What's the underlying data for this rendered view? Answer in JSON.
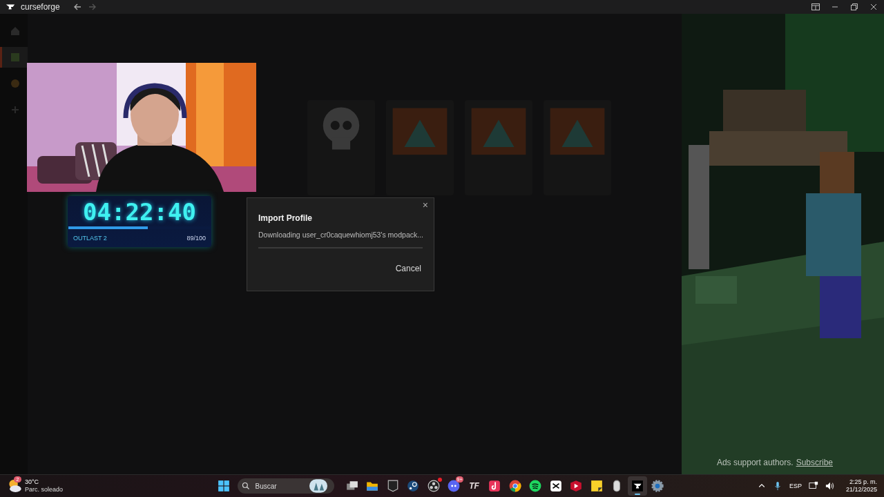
{
  "window": {
    "app_name": "curseforge",
    "back_disabled": false,
    "forward_disabled": true
  },
  "sidebar": {
    "items": [
      {
        "kind": "home",
        "selected": false
      },
      {
        "kind": "game",
        "selected": true
      },
      {
        "kind": "game2",
        "selected": false
      },
      {
        "kind": "add",
        "selected": false
      }
    ]
  },
  "library": {
    "cards": [
      {
        "kind": "skull"
      },
      {
        "kind": "art"
      },
      {
        "kind": "art"
      },
      {
        "kind": "art"
      }
    ]
  },
  "timer": {
    "time": "04:22:40",
    "level": 0.56,
    "game": "OUTLAST 2",
    "count": "89/100"
  },
  "dialog": {
    "title": "Import Profile",
    "message": "Downloading user_cr0caquewhiomj53's modpack...",
    "level": 0,
    "cancel": "Cancel",
    "close": "×"
  },
  "ad": {
    "kind": "picture",
    "note": "Ads support authors.",
    "link": "Subscribe"
  },
  "taskbar": {
    "weather": {
      "temp": "30°C",
      "condition": "Parc. soleado",
      "badge": "2"
    },
    "search": {
      "placeholder": "Buscar"
    },
    "apps": [
      {
        "kind": "task-view",
        "selected": false
      },
      {
        "kind": "folder",
        "selected": false
      },
      {
        "kind": "epic",
        "selected": false
      },
      {
        "kind": "steam",
        "selected": false
      },
      {
        "kind": "obs",
        "selected": false,
        "dot": true
      },
      {
        "kind": "discord",
        "selected": false,
        "badge": "9+"
      },
      {
        "kind": "tf",
        "selected": false,
        "label": "TF"
      },
      {
        "kind": "tiktok",
        "selected": false
      },
      {
        "kind": "chrome",
        "selected": false
      },
      {
        "kind": "spotify",
        "selected": false
      },
      {
        "kind": "capcut",
        "selected": false
      },
      {
        "kind": "player",
        "selected": false
      },
      {
        "kind": "notes",
        "selected": false
      },
      {
        "kind": "mouse",
        "selected": false
      },
      {
        "kind": "curseforge",
        "selected": true
      },
      {
        "kind": "settings",
        "selected": false
      }
    ],
    "language": "ESP",
    "time": "2:25 p. m.",
    "date": "21/12/2025"
  }
}
